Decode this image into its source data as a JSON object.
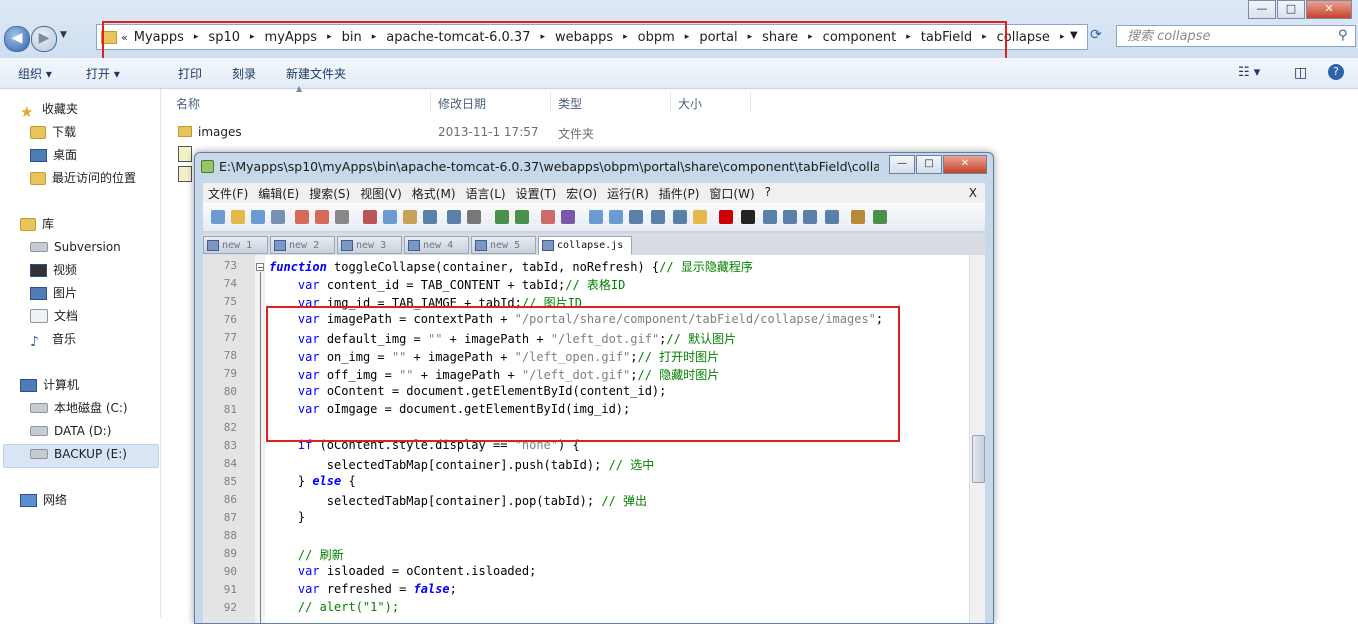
{
  "explorer": {
    "nav_back": "◀",
    "nav_forward": "▶",
    "breadcrumb_prefix": "«",
    "breadcrumbs": [
      "Myapps",
      "sp10",
      "myApps",
      "bin",
      "apache-tomcat-6.0.37",
      "webapps",
      "obpm",
      "portal",
      "share",
      "component",
      "tabField",
      "collapse"
    ],
    "search_placeholder": "搜索 collapse",
    "toolbar": {
      "organize": "组织 ▾",
      "open": "打开 ▾",
      "print": "打印",
      "burn": "刻录",
      "new_folder": "新建文件夹"
    },
    "window_controls": {
      "minimize": "—",
      "maximize": "□",
      "close": "✕"
    },
    "sidebar": {
      "favorites": "收藏夹",
      "fav_items": [
        "下载",
        "桌面",
        "最近访问的位置"
      ],
      "libraries": "库",
      "lib_items": [
        "Subversion",
        "视频",
        "图片",
        "文档",
        "音乐"
      ],
      "computer": "计算机",
      "drives": [
        "本地磁盘 (C:)",
        "DATA (D:)",
        "BACKUP (E:)"
      ],
      "network": "网络"
    },
    "columns": {
      "name": "名称",
      "modified": "修改日期",
      "type": "类型",
      "size": "大小"
    },
    "files": [
      {
        "name": "images",
        "modified": "2013-11-1 17:57",
        "type": "文件夹",
        "size": ""
      }
    ]
  },
  "notepad": {
    "title": "E:\\Myapps\\sp10\\myApps\\bin\\apache-tomcat-6.0.37\\webapps\\obpm\\portal\\share\\component\\tabField\\collapse...",
    "menu": [
      "文件(F)",
      "编辑(E)",
      "搜索(S)",
      "视图(V)",
      "格式(M)",
      "语言(L)",
      "设置(T)",
      "宏(O)",
      "运行(R)",
      "插件(P)",
      "窗口(W)",
      "?"
    ],
    "menu_close": "X",
    "tabs": [
      "new 1",
      "new 2",
      "new 3",
      "new 4",
      "new 5",
      "collapse.js"
    ],
    "active_tab": "collapse.js",
    "lines": [
      {
        "n": "73",
        "code": [
          [
            "kwi",
            "function"
          ],
          [
            "p",
            " toggleCollapse(container, tabId, noRefresh) {"
          ],
          [
            "cmt",
            "// 显示隐藏程序"
          ]
        ]
      },
      {
        "n": "74",
        "code": [
          [
            "p",
            "    "
          ],
          [
            "kw",
            "var"
          ],
          [
            "p",
            " content_id = TAB_CONTENT + tabId;"
          ],
          [
            "cmt",
            "// 表格ID"
          ]
        ]
      },
      {
        "n": "75",
        "code": [
          [
            "p",
            "    "
          ],
          [
            "kw",
            "var"
          ],
          [
            "p",
            " img_id = TAB_IAMGE + tabId;"
          ],
          [
            "cmt",
            "// 图片ID"
          ]
        ]
      },
      {
        "n": "76",
        "code": [
          [
            "p",
            "    "
          ],
          [
            "kw",
            "var"
          ],
          [
            "p",
            " imagePath = contextPath + "
          ],
          [
            "str",
            "\"/portal/share/component/tabField/collapse/images\""
          ],
          [
            "p",
            ";"
          ]
        ]
      },
      {
        "n": "77",
        "code": [
          [
            "p",
            "    "
          ],
          [
            "kw",
            "var"
          ],
          [
            "p",
            " default_img = "
          ],
          [
            "str",
            "\"\""
          ],
          [
            "p",
            " + imagePath + "
          ],
          [
            "str",
            "\"/left_dot.gif\""
          ],
          [
            "p",
            ";"
          ],
          [
            "cmt",
            "// 默认图片"
          ]
        ]
      },
      {
        "n": "78",
        "code": [
          [
            "p",
            "    "
          ],
          [
            "kw",
            "var"
          ],
          [
            "p",
            " on_img = "
          ],
          [
            "str",
            "\"\""
          ],
          [
            "p",
            " + imagePath + "
          ],
          [
            "str",
            "\"/left_open.gif\""
          ],
          [
            "p",
            ";"
          ],
          [
            "cmt",
            "// 打开时图片"
          ]
        ]
      },
      {
        "n": "79",
        "code": [
          [
            "p",
            "    "
          ],
          [
            "kw",
            "var"
          ],
          [
            "p",
            " off_img = "
          ],
          [
            "str",
            "\"\""
          ],
          [
            "p",
            " + imagePath + "
          ],
          [
            "str",
            "\"/left_dot.gif\""
          ],
          [
            "p",
            ";"
          ],
          [
            "cmt",
            "// 隐藏时图片"
          ]
        ]
      },
      {
        "n": "80",
        "code": [
          [
            "p",
            "    "
          ],
          [
            "kw",
            "var"
          ],
          [
            "p",
            " oContent = document.getElementById(content_id);"
          ]
        ]
      },
      {
        "n": "81",
        "code": [
          [
            "p",
            "    "
          ],
          [
            "kw",
            "var"
          ],
          [
            "p",
            " oImgage = document.getElementById(img_id);"
          ]
        ]
      },
      {
        "n": "82",
        "code": []
      },
      {
        "n": "83",
        "code": [
          [
            "p",
            "    "
          ],
          [
            "kw",
            "if"
          ],
          [
            "p",
            " (oContent.style.display == "
          ],
          [
            "str",
            "\"none\""
          ],
          [
            "p",
            ") {"
          ]
        ]
      },
      {
        "n": "84",
        "code": [
          [
            "p",
            "        selectedTabMap[container].push(tabId); "
          ],
          [
            "cmt",
            "// 选中"
          ]
        ]
      },
      {
        "n": "85",
        "code": [
          [
            "p",
            "    } "
          ],
          [
            "kwi",
            "else"
          ],
          [
            "p",
            " {"
          ]
        ]
      },
      {
        "n": "86",
        "code": [
          [
            "p",
            "        selectedTabMap[container].pop(tabId); "
          ],
          [
            "cmt",
            "// 弹出"
          ]
        ]
      },
      {
        "n": "87",
        "code": [
          [
            "p",
            "    }"
          ]
        ]
      },
      {
        "n": "88",
        "code": []
      },
      {
        "n": "89",
        "code": [
          [
            "p",
            "    "
          ],
          [
            "cmt",
            "// 刷新"
          ]
        ]
      },
      {
        "n": "90",
        "code": [
          [
            "p",
            "    "
          ],
          [
            "kw",
            "var"
          ],
          [
            "p",
            " isloaded = oContent.isloaded;"
          ]
        ]
      },
      {
        "n": "91",
        "code": [
          [
            "p",
            "    "
          ],
          [
            "kw",
            "var"
          ],
          [
            "p",
            " refreshed = "
          ],
          [
            "kwi",
            "false"
          ],
          [
            "p",
            ";"
          ]
        ]
      },
      {
        "n": "92",
        "code": [
          [
            "p",
            "    "
          ],
          [
            "cmt",
            "// alert(\"1\");"
          ]
        ]
      }
    ]
  },
  "colors": {
    "highlight": "#e02020",
    "keyword": "#0000ff",
    "comment": "#008000",
    "string": "#808080"
  }
}
